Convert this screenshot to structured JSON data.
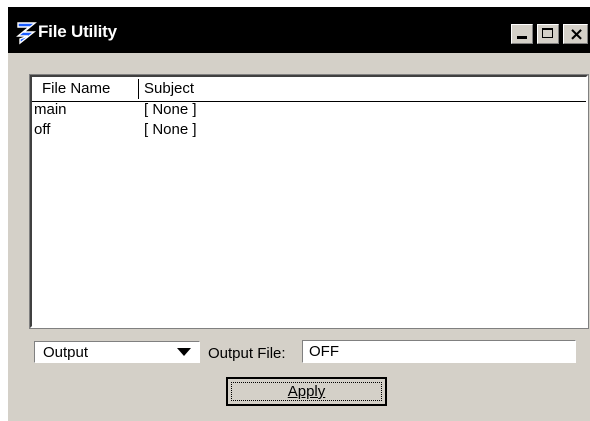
{
  "window": {
    "title": "File Utility",
    "controls": {
      "minimize": "minimize",
      "maximize": "maximize",
      "close": "close"
    },
    "colors": {
      "titlebar": "#000000",
      "face": "#d4d0c8",
      "title_text": "#ffffff"
    }
  },
  "list": {
    "columns": [
      "File Name",
      "Subject"
    ],
    "rows": [
      {
        "name": "main",
        "subject": "[ None ]"
      },
      {
        "name": "off",
        "subject": "[ None ]"
      }
    ]
  },
  "controls": {
    "mode_select": {
      "value": "Output"
    },
    "output_label": "Output File:",
    "output_file": "OFF",
    "apply_label": "Apply"
  },
  "icons": {
    "app": "app-logo-icon",
    "dropdown": "chevron-down-icon"
  }
}
